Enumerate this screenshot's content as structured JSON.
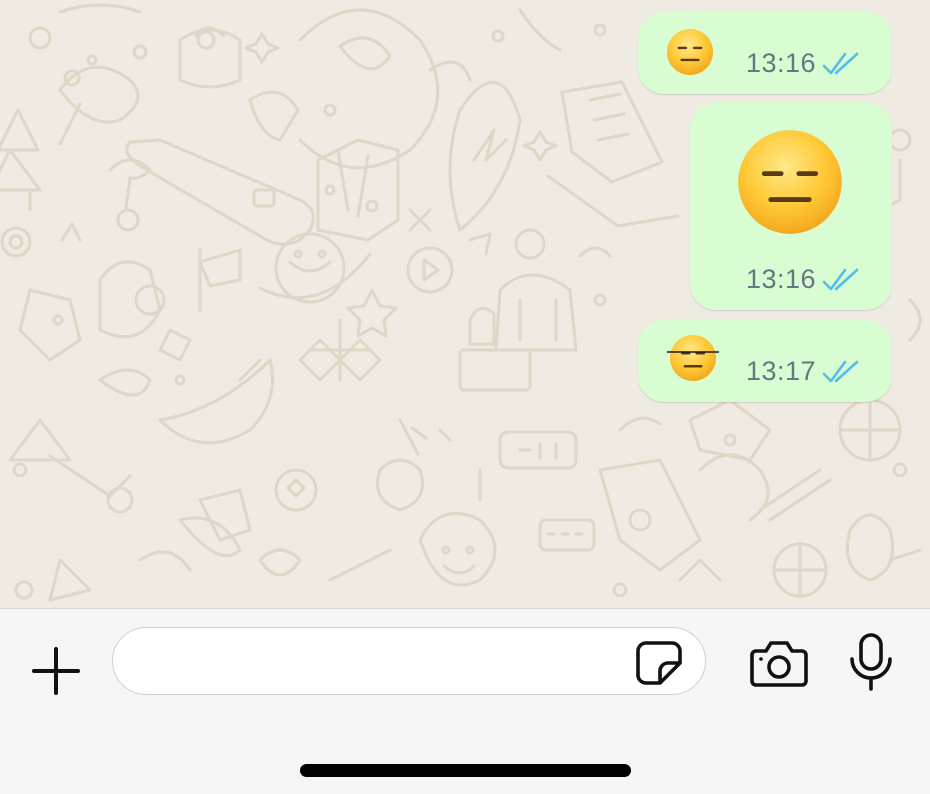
{
  "messages": [
    {
      "emoji": "expressionless-face",
      "size": "small",
      "time": "13:16",
      "status": "read"
    },
    {
      "emoji": "expressionless-face",
      "size": "large",
      "time": "13:16",
      "status": "read"
    },
    {
      "emoji": "expressionless-face-struck-through",
      "size": "small",
      "time": "13:17",
      "status": "read"
    }
  ],
  "composer": {
    "input_value": "",
    "input_placeholder": ""
  },
  "icons": {
    "attach": "plus-icon",
    "sticker": "sticker-icon",
    "camera": "camera-icon",
    "mic": "microphone-icon",
    "read_receipt": "double-check-icon"
  },
  "colors": {
    "chat_background": "#efeae2",
    "outgoing_bubble": "#d9fdd3",
    "timestamp": "#667781",
    "read_tick": "#53bdeb",
    "composer_background": "#f6f6f6"
  }
}
